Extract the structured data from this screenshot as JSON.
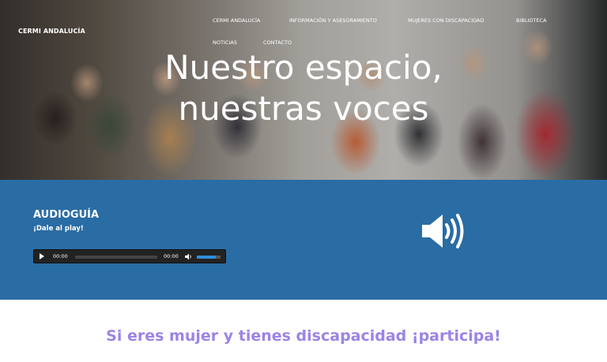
{
  "brand": "CERMI ANDALUCÍA",
  "nav": {
    "items": [
      {
        "label": "CERMI ANDALUCÍA"
      },
      {
        "label": "INFORMACIÓN Y ASESORAMIENTO"
      },
      {
        "label": "MUJERES CON DISCAPACIDAD"
      },
      {
        "label": "BIBLIOTECA"
      },
      {
        "label": "NOTICIAS"
      },
      {
        "label": "CONTACTO"
      }
    ]
  },
  "hero": {
    "title_line1": "Nuestro espacio,",
    "title_line2": "nuestras voces"
  },
  "audio": {
    "title": "AUDIOGUÍA",
    "subtitle": "¡Dale al play!",
    "player": {
      "current_time": "00:00",
      "duration": "00:00",
      "progress": 0,
      "volume": 0.8
    },
    "icon": "speaker-volume-icon",
    "background": "#2a6ca4"
  },
  "cta": {
    "text": "Si eres mujer y tienes discapacidad ¡participa!",
    "color": "#9b84e6"
  }
}
